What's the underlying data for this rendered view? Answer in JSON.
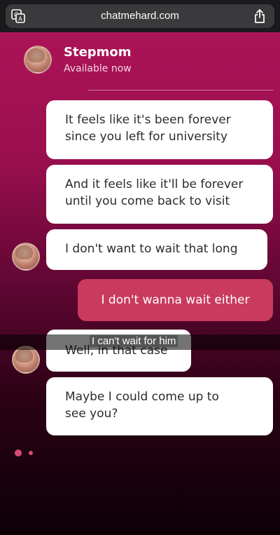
{
  "browser": {
    "url": "chatmehard.com",
    "left_icon": "translate-icon",
    "right_icon": "share-icon"
  },
  "contact": {
    "name": "Stepmom",
    "status": "Available now",
    "avatar_icon": "avatar"
  },
  "messages": [
    {
      "from": "contact",
      "lines": [
        "It feels like it's been forever",
        "since you left for university"
      ]
    },
    {
      "from": "contact",
      "lines": [
        "And it feels like it'll be forever",
        "until you come back to visit"
      ]
    },
    {
      "from": "contact",
      "lines": [
        "I don't want to wait that long"
      ]
    },
    {
      "from": "user",
      "lines": [
        "I don't wanna wait either"
      ]
    },
    {
      "from": "contact",
      "lines": [
        "Well, in that case"
      ]
    },
    {
      "from": "contact",
      "lines": [
        "Maybe I could come up to",
        "see you?"
      ]
    }
  ],
  "subtitle": "I can't wait for him",
  "colors": {
    "brand": "#b0155a",
    "sent_bubble": "#c93a5e",
    "typing_dot": "#d94a72"
  }
}
